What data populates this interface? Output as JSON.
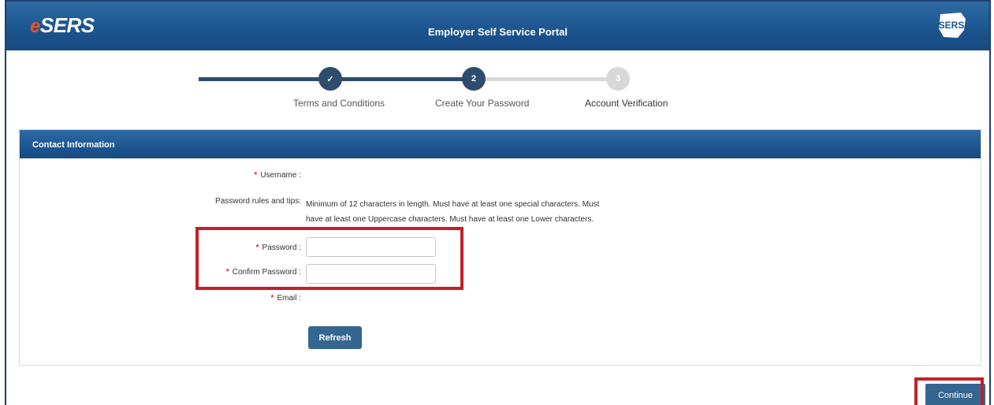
{
  "header": {
    "logo_prefix": "e",
    "logo_main": "SERS",
    "title": "Employer Self Service Portal",
    "seal_icon": "ohio-seal-icon"
  },
  "stepper": {
    "steps": [
      {
        "marker": "✓",
        "label": "Terms and Conditions",
        "state": "complete"
      },
      {
        "marker": "2",
        "label": "Create Your Password",
        "state": "current"
      },
      {
        "marker": "3",
        "label": "Account Verification",
        "state": "upcoming"
      }
    ]
  },
  "panel": {
    "title": "Contact Information",
    "required_mark": "*",
    "username_label": "Username :",
    "rules_label": "Password rules and tips:",
    "rules_line1": "Minimum of 12 characters in length. Must have at least one special characters. Must",
    "rules_line2": "have at least one Uppercase characters. Must have at least one Lower characters.",
    "password_label": "Password :",
    "password_value": "",
    "confirm_label": "Confirm Password :",
    "confirm_value": "",
    "email_label": "Email :",
    "refresh_label": "Refresh"
  },
  "footer": {
    "continue_label": "Continue"
  },
  "colors": {
    "header_blue": "#1d5590",
    "button_blue": "#35668f",
    "step_active": "#2e4c6d",
    "step_inactive": "#d8d8d8",
    "highlight_red": "#c3202a",
    "required_red": "#d0312d"
  }
}
